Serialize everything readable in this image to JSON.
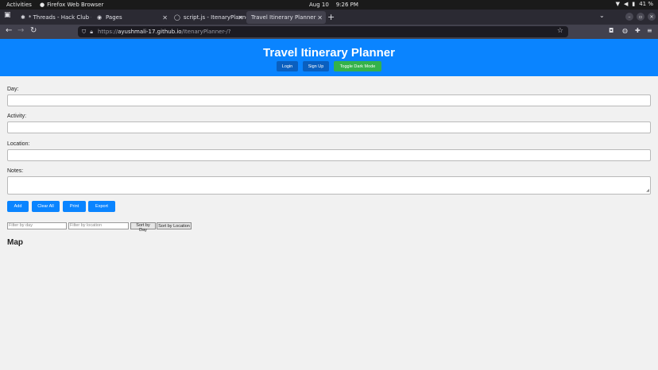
{
  "system": {
    "activities": "Activities",
    "app_name": "Firefox Web Browser",
    "date": "Aug 10",
    "time": "9:26 PM",
    "battery": "41 %"
  },
  "tabs": [
    {
      "label": "* Threads - Hack Club - Sl",
      "icon": "slack-icon"
    },
    {
      "label": "Pages",
      "icon": "github-icon"
    },
    {
      "label": "script.js - ItenaryPlanner-",
      "icon": "github-icon"
    },
    {
      "label": "Travel Itinerary Planner",
      "active": true
    }
  ],
  "url": {
    "scheme": "https://",
    "host": "ayushmali-17.github.io",
    "path": "/ItenaryPlanner-/?"
  },
  "page": {
    "title": "Travel Itinerary Planner",
    "header_buttons": {
      "login": "Login",
      "signup": "Sign Up",
      "dark": "Toggle Dark Mode"
    },
    "form": {
      "day_label": "Day:",
      "activity_label": "Activity:",
      "location_label": "Location:",
      "notes_label": "Notes:"
    },
    "actions": {
      "add": "Add",
      "clear": "Clear All",
      "print": "Print",
      "export": "Export"
    },
    "filters": {
      "day_placeholder": "Filter by day",
      "location_placeholder": "Filter by location",
      "sort_day": "Sort by Day",
      "sort_location": "Sort by Location"
    },
    "map_heading": "Map"
  },
  "colors": {
    "header_blue": "#0a84ff",
    "header_button_blue": "#0a5fbf",
    "dark_toggle_green": "#34b24a",
    "action_button_blue": "#0a84ff"
  }
}
